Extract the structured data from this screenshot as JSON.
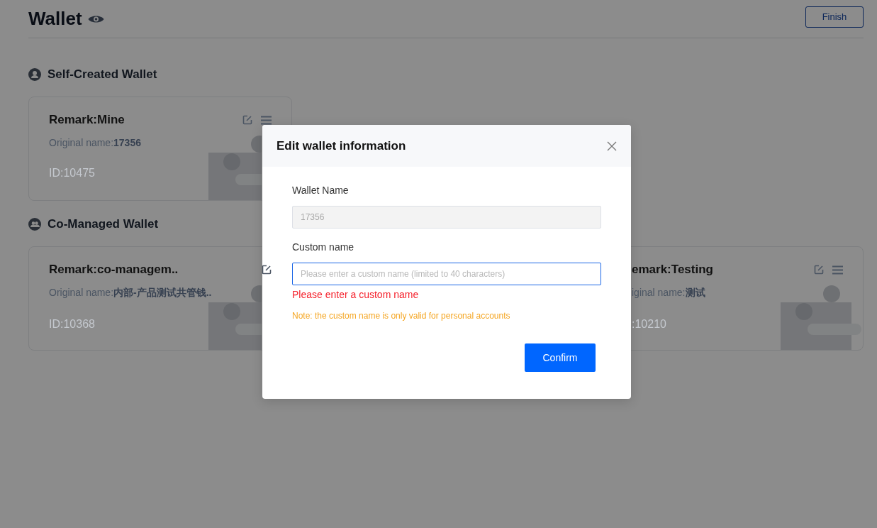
{
  "header": {
    "title": "Wallet",
    "finish_button": "Finish"
  },
  "sections": [
    {
      "kind": "self",
      "title": "Self-Created Wallet",
      "cards": [
        {
          "remark": "Remark:Mine",
          "original": "Original name:**17356**",
          "id": "ID:10475",
          "icons": [
            {
              "kind": "edit"
            },
            {
              "kind": "menu"
            }
          ]
        }
      ]
    },
    {
      "kind": "co",
      "title": "Co-Managed Wallet",
      "cards": [
        {
          "remark": "Remark:co-managem..",
          "original": "Original name:**内部-产品测试共管钱..**",
          "id": "ID:10368",
          "icons": [
            {
              "kind": "edit"
            }
          ]
        },
        {
          "remark": "emark:Testing",
          "original": "iginal name:**测试**",
          "id": ":10210",
          "icons": [
            {
              "kind": "edit"
            },
            {
              "kind": "menu"
            }
          ]
        }
      ]
    }
  ],
  "dialog": {
    "title": "Edit wallet information",
    "fields": [
      {
        "label": "Wallet Name",
        "value": "17356",
        "disabled": true,
        "focused": false
      },
      {
        "label": "Custom name",
        "placeholder": "Please enter a custom name (limited to 40 characters)",
        "disabled": false,
        "focused": true,
        "error": "Please enter a custom name"
      }
    ],
    "note": "Note: the custom name is only valid for personal accounts",
    "confirm_button": "Confirm"
  }
}
